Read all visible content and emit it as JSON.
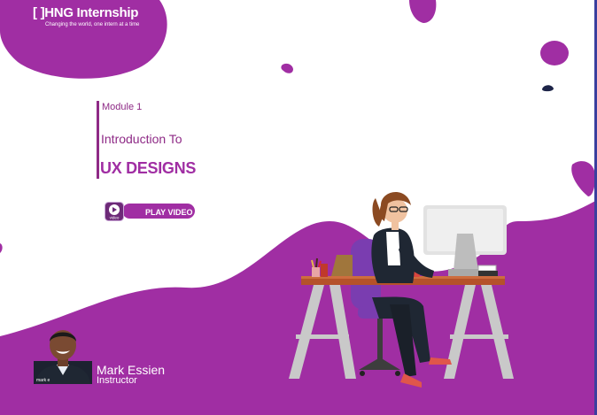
{
  "brand": {
    "logo_text": "[ ]HNG Internship",
    "tagline": "Changing the world, one intern at a time"
  },
  "lesson": {
    "module_label": "Module 1",
    "intro_label": "Introduction To",
    "title": "UX DESIGNS"
  },
  "play": {
    "badge_text": "video",
    "button_label": "PLAY VIDEO"
  },
  "instructor": {
    "name": "Mark Essien",
    "role": "Instructor",
    "photo_caption": "mark e"
  },
  "colors": {
    "brand_purple": "#a02ea3",
    "dark_purple": "#8e2a86",
    "background": "#ffffff"
  },
  "icons": {
    "play": "play-icon"
  }
}
